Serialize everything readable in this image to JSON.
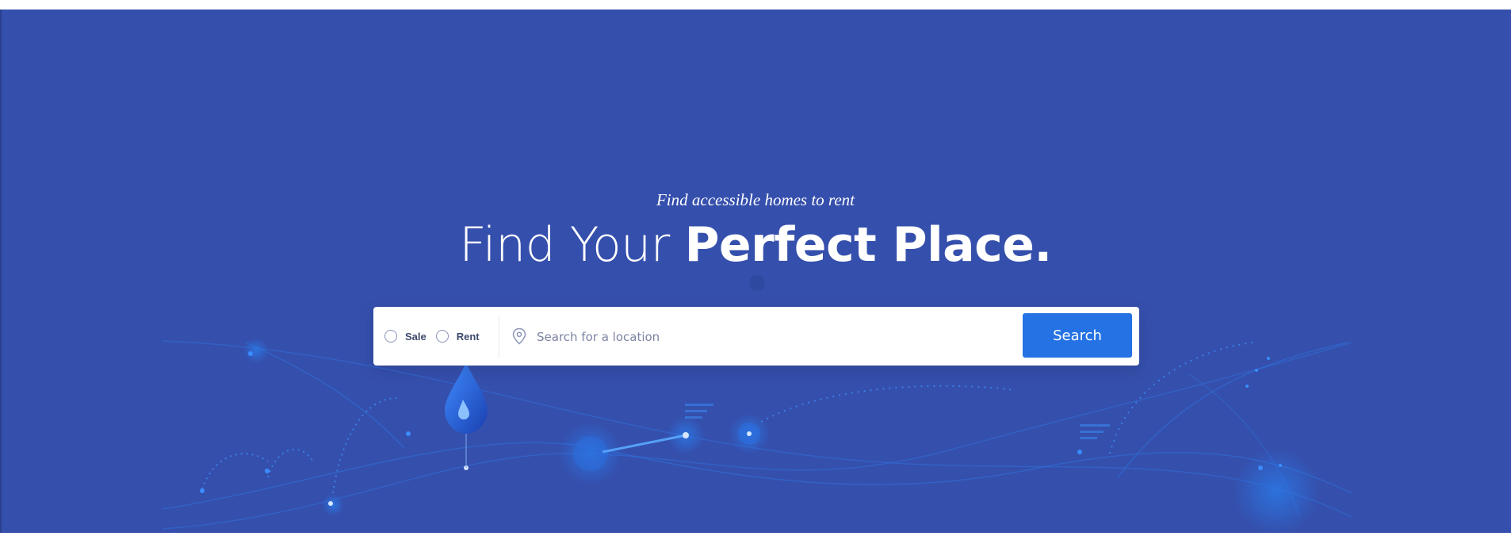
{
  "hero": {
    "tagline": "Find accessible homes to rent",
    "headline_light": "Find Your ",
    "headline_bold": "Perfect Place."
  },
  "search": {
    "options": [
      {
        "label": "Sale",
        "selected": false
      },
      {
        "label": "Rent",
        "selected": false
      }
    ],
    "placeholder": "Search for a location",
    "button_label": "Search"
  },
  "colors": {
    "background": "#354fac",
    "button": "#2472e4",
    "accent_glow": "#1e6fe8"
  },
  "icons": {
    "location": "map-pin-icon",
    "decoration_drop": "water-drop-pin-icon"
  }
}
